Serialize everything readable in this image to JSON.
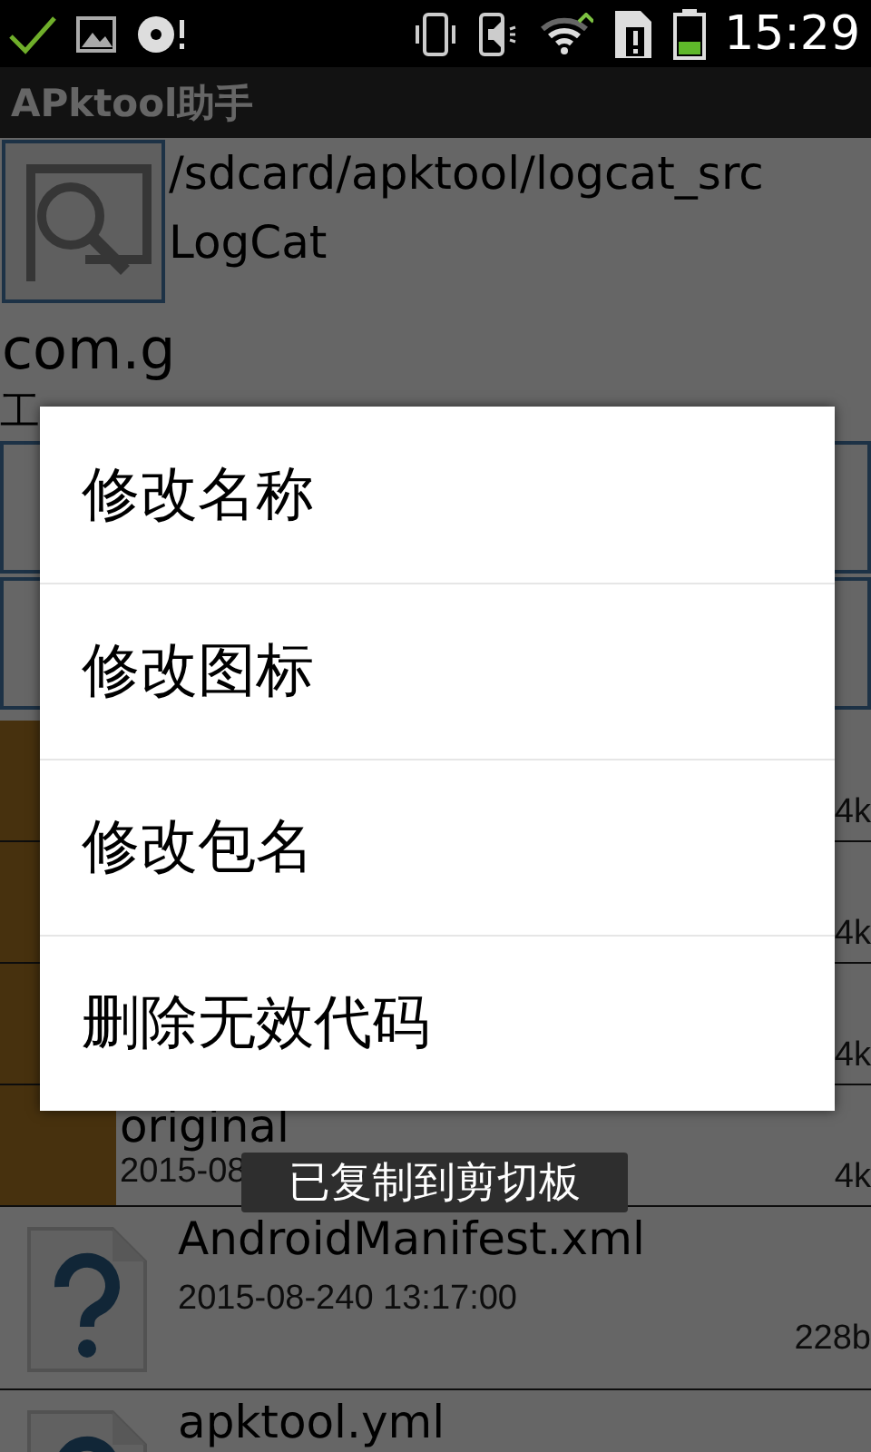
{
  "status_bar": {
    "time": "15:29"
  },
  "title": "APktool助手",
  "project": {
    "path": "/sdcard/apktool/logcat_src",
    "name": "LogCat",
    "package": "com.g",
    "type_line": "工"
  },
  "files": [
    {
      "kind": "folder",
      "size": "4k"
    },
    {
      "kind": "folder",
      "size": "4k"
    },
    {
      "kind": "folder",
      "size": "4k"
    },
    {
      "kind": "folder",
      "name": "original",
      "date": "2015-08",
      "size": "4k"
    },
    {
      "kind": "unknown",
      "name": "AndroidManifest.xml",
      "date": "2015-08-240 13:17:00",
      "size": "228b"
    },
    {
      "kind": "unknown",
      "name": "apktool.yml"
    }
  ],
  "menu": {
    "items": [
      "修改名称",
      "修改图标",
      "修改包名",
      "删除无效代码"
    ]
  },
  "toast": "已复制到剪切板"
}
